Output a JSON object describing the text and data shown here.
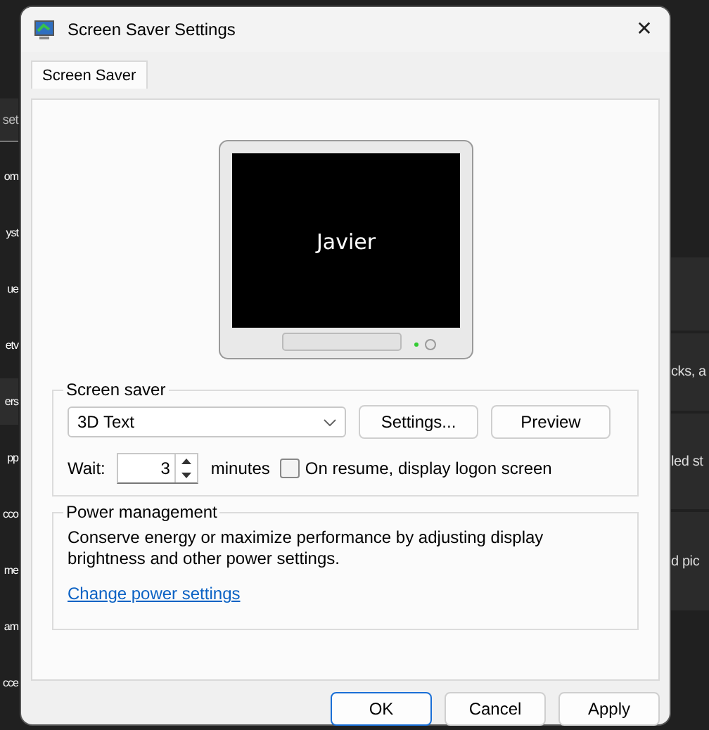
{
  "background_window": {
    "search": "set",
    "nav_items": [
      {
        "label": "om",
        "selected": false
      },
      {
        "label": "yst",
        "selected": false
      },
      {
        "label": "ue",
        "selected": false
      },
      {
        "label": "etv",
        "selected": false
      },
      {
        "label": "ers",
        "selected": true
      },
      {
        "label": "pp",
        "selected": false
      },
      {
        "label": "cco",
        "selected": false
      },
      {
        "label": "me",
        "selected": false
      },
      {
        "label": "am",
        "selected": false
      },
      {
        "label": "cce",
        "selected": false
      }
    ],
    "cards": [
      "cks, a",
      "led st",
      "d pic"
    ]
  },
  "dialog": {
    "title": "Screen Saver Settings",
    "close": "✕",
    "tabs": [
      {
        "label": "Screen Saver",
        "selected": true
      }
    ],
    "preview": {
      "text": "Javier"
    },
    "screen_saver": {
      "legend": "Screen saver",
      "selected_option": "3D Text",
      "buttons": [
        "Settings...",
        "Preview"
      ],
      "wait_label": "Wait:",
      "wait_value": "3",
      "wait_unit": "minutes",
      "logon_checkbox": {
        "label": "On resume, display logon screen",
        "checked": false
      }
    },
    "power": {
      "legend": "Power management",
      "description": "Conserve energy or maximize performance by adjusting display brightness and other power settings.",
      "link": "Change power settings"
    },
    "buttons": [
      {
        "label": "OK",
        "default": true
      },
      {
        "label": "Cancel",
        "default": false
      },
      {
        "label": "Apply",
        "default": false
      }
    ]
  }
}
